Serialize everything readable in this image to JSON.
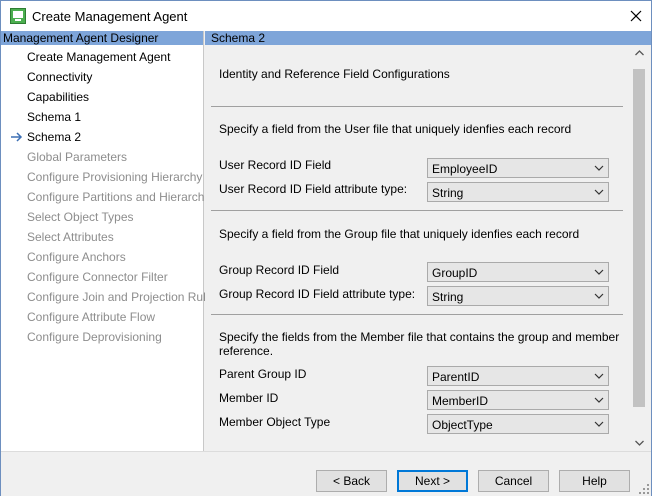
{
  "window": {
    "title": "Create Management Agent"
  },
  "left_pane": {
    "header": "Management Agent Designer",
    "items": [
      {
        "label": "Create Management Agent",
        "enabled": true,
        "current": false
      },
      {
        "label": "Connectivity",
        "enabled": true,
        "current": false
      },
      {
        "label": "Capabilities",
        "enabled": true,
        "current": false
      },
      {
        "label": "Schema 1",
        "enabled": true,
        "current": false
      },
      {
        "label": "Schema 2",
        "enabled": true,
        "current": true
      },
      {
        "label": "Global Parameters",
        "enabled": false,
        "current": false
      },
      {
        "label": "Configure Provisioning Hierarchy",
        "enabled": false,
        "current": false
      },
      {
        "label": "Configure Partitions and Hierarchies",
        "enabled": false,
        "current": false
      },
      {
        "label": "Select Object Types",
        "enabled": false,
        "current": false
      },
      {
        "label": "Select Attributes",
        "enabled": false,
        "current": false
      },
      {
        "label": "Configure Anchors",
        "enabled": false,
        "current": false
      },
      {
        "label": "Configure Connector Filter",
        "enabled": false,
        "current": false
      },
      {
        "label": "Configure Join and Projection Rules",
        "enabled": false,
        "current": false
      },
      {
        "label": "Configure Attribute Flow",
        "enabled": false,
        "current": false
      },
      {
        "label": "Configure Deprovisioning",
        "enabled": false,
        "current": false
      }
    ]
  },
  "right_pane": {
    "header": "Schema 2",
    "section_title": "Identity and Reference Field Configurations",
    "user": {
      "description": "Specify a field from the User file that uniquely idenfies each record",
      "record_id_label": "User Record ID Field",
      "record_id_value": "EmployeeID",
      "attr_type_label": "User Record ID Field attribute type:",
      "attr_type_value": "String"
    },
    "group": {
      "description": "Specify a field from the Group file that uniquely idenfies each record",
      "record_id_label": "Group Record ID Field",
      "record_id_value": "GroupID",
      "attr_type_label": "Group Record ID Field attribute type:",
      "attr_type_value": "String"
    },
    "member": {
      "description_line1": "Specify the fields from the Member file that contains the group and member",
      "description_line2": "reference.",
      "parent_group_label": "Parent Group ID",
      "parent_group_value": "ParentID",
      "member_id_label": "Member ID",
      "member_id_value": "MemberID",
      "member_type_label": "Member Object Type",
      "member_type_value": "ObjectType"
    }
  },
  "buttons": {
    "back": "< Back",
    "next": "Next >",
    "cancel": "Cancel",
    "help": "Help"
  },
  "colors": {
    "pane_header": "#7ea5d9",
    "default_button_border": "#0078d7"
  },
  "icons": [
    "app-icon",
    "close-icon",
    "current-step-arrow-icon",
    "chevron-down-icon",
    "scroll-up-icon",
    "scroll-down-icon",
    "resize-grip-icon"
  ]
}
